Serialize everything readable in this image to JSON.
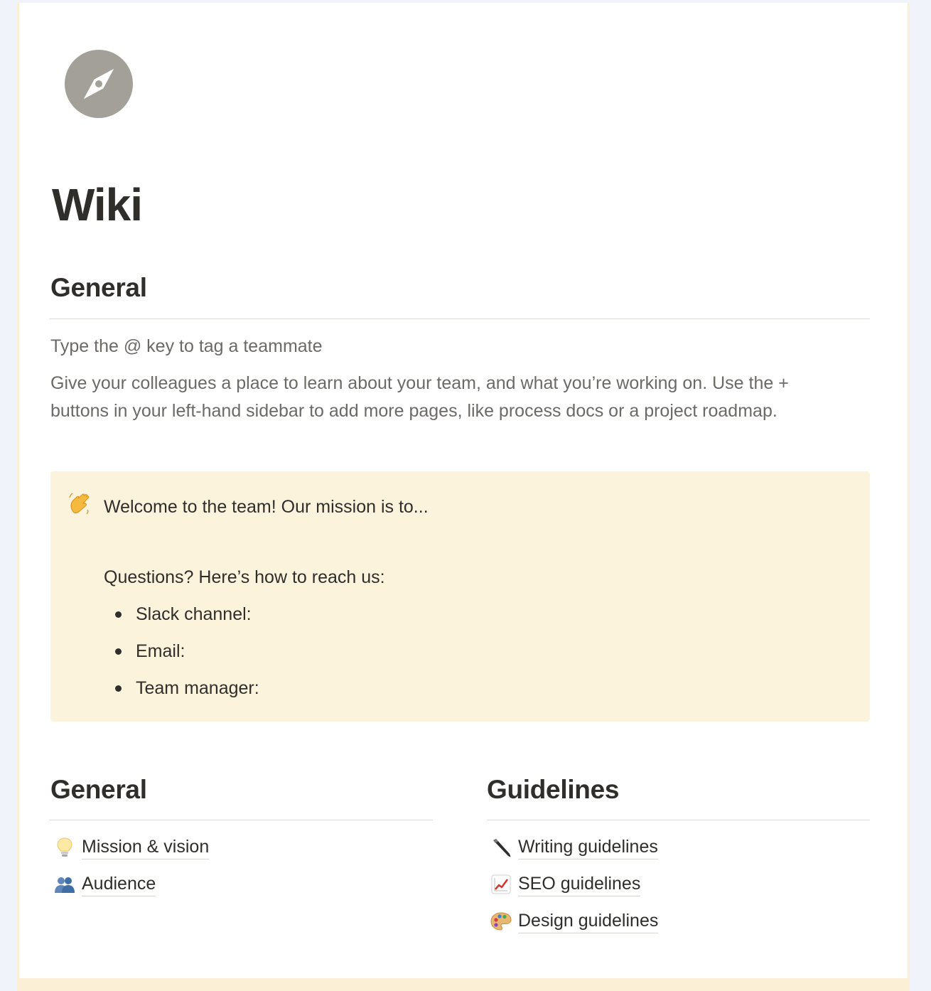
{
  "page": {
    "icon": "compass-icon",
    "title": "Wiki"
  },
  "general_section": {
    "heading": "General",
    "hint": "Type the @ key to tag a teammate",
    "description_line1": "Give your colleagues a place to learn about your team, and what you’re working on. Use the +",
    "description_line2": "buttons in your left-hand sidebar to add more pages, like process docs or a project roadmap."
  },
  "callout": {
    "emoji": "waving-hand-icon",
    "welcome": "Welcome to the team! Our mission is to...",
    "questions": "Questions? Here’s how to reach us:",
    "items": [
      "Slack channel:",
      "Email:",
      "Team manager:"
    ]
  },
  "columns": {
    "left": {
      "heading": "General",
      "links": [
        {
          "icon": "lightbulb-icon",
          "label": "Mission & vision"
        },
        {
          "icon": "people-icon",
          "label": "Audience"
        }
      ]
    },
    "right": {
      "heading": "Guidelines",
      "links": [
        {
          "icon": "pen-icon",
          "label": "Writing guidelines"
        },
        {
          "icon": "chart-increasing-icon",
          "label": "SEO guidelines"
        },
        {
          "icon": "palette-icon",
          "label": "Design guidelines"
        }
      ]
    }
  },
  "colors": {
    "callout_bg": "#fbf3dc",
    "frame_accent": "#fbf0d6",
    "icon_gray": "#a39f99"
  }
}
